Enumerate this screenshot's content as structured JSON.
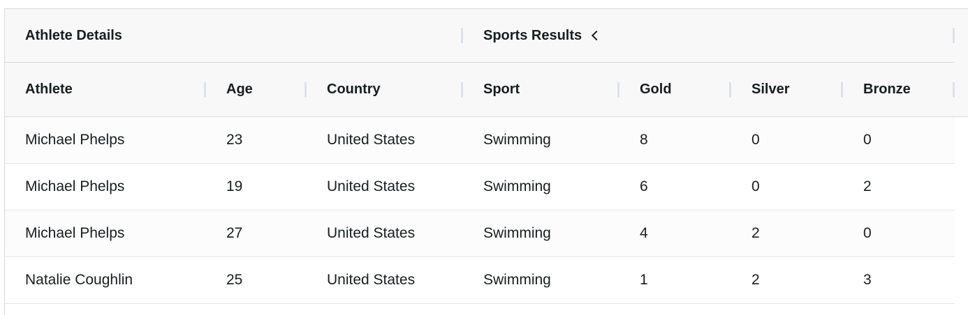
{
  "column_groups": [
    {
      "label": "Athlete Details"
    },
    {
      "label": "Sports Results"
    }
  ],
  "columns": [
    {
      "label": "Athlete"
    },
    {
      "label": "Age"
    },
    {
      "label": "Country"
    },
    {
      "label": "Sport"
    },
    {
      "label": "Gold"
    },
    {
      "label": "Silver"
    },
    {
      "label": "Bronze"
    }
  ],
  "rows": [
    {
      "athlete": "Michael Phelps",
      "age": "23",
      "country": "United States",
      "sport": "Swimming",
      "gold": "8",
      "silver": "0",
      "bronze": "0"
    },
    {
      "athlete": "Michael Phelps",
      "age": "19",
      "country": "United States",
      "sport": "Swimming",
      "gold": "6",
      "silver": "0",
      "bronze": "2"
    },
    {
      "athlete": "Michael Phelps",
      "age": "27",
      "country": "United States",
      "sport": "Swimming",
      "gold": "4",
      "silver": "2",
      "bronze": "0"
    },
    {
      "athlete": "Natalie Coughlin",
      "age": "25",
      "country": "United States",
      "sport": "Swimming",
      "gold": "1",
      "silver": "2",
      "bronze": "3"
    }
  ],
  "colors": {
    "header_bg": "#f8f8f8",
    "border": "#d9dadc",
    "text": "#181d1f"
  },
  "icons": {
    "group_toggle": "chevron-left-icon"
  }
}
